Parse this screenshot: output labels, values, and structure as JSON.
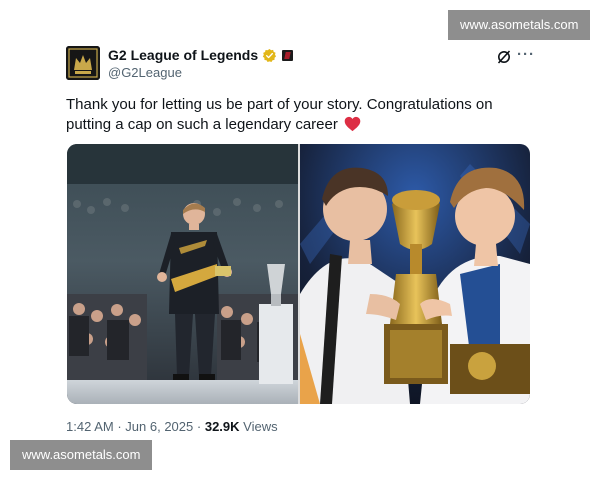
{
  "watermarks": {
    "top": "www.asometals.com",
    "bottom": "www.asometals.com"
  },
  "tweet": {
    "author": {
      "display_name": "G2 League of Legends",
      "handle": "@G2League",
      "avatar": "g2-logo",
      "verified_badge": "gold-verified-badge",
      "affiliate_badge": "g2-affiliate-badge"
    },
    "actions": {
      "grok": "grok-icon",
      "more": "···"
    },
    "text": "Thank you for letting us be part of your story. Congratulations on putting a cap on such a legendary career",
    "emoji": "red-heart",
    "media": [
      {
        "name": "player-walking-on-stage-photo"
      },
      {
        "name": "players-kissing-trophy-photo"
      }
    ],
    "meta": {
      "time": "1:42 AM",
      "sep1": "·",
      "date": "Jun 6, 2025",
      "sep2": "·",
      "views_count": "32.9K",
      "views_label": "Views"
    },
    "colors": {
      "text": "#0f1419",
      "secondary": "#536471",
      "verified": "#e2b719",
      "heart": "#e0245e"
    }
  }
}
